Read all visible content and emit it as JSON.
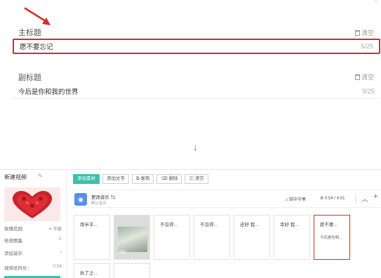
{
  "annotation": {
    "corner_mark": "ʼ",
    "down_arrow": "↓"
  },
  "main_title_field": {
    "label": "主标题",
    "clear": "清空",
    "value": "愿不要忘记",
    "count": "5/25"
  },
  "subtitle_field": {
    "label": "副标题",
    "clear": "清空",
    "value": "今后是你和我的世界",
    "count": "9/25"
  },
  "editor": {
    "project_title": "新建视频",
    "style_row": {
      "label": "玫瑰花园",
      "value": "▾ 浮雕"
    },
    "rows": [
      {
        "label": "修改图集",
        "icon": "A"
      },
      {
        "label": "添加音乐",
        "icon": "♪"
      },
      {
        "label": "视频总时长：",
        "value": "0:54"
      }
    ],
    "toolbar": {
      "add_material": "添加素材",
      "add_text": "添加文字",
      "copy": "复制",
      "delete": "删除",
      "clear": "清空"
    },
    "music": {
      "title": "更改音乐 ⇆",
      "subtitle": "默认音乐",
      "beat": "踩中节奏",
      "timer": "0:54 / 4:01"
    },
    "clips": [
      {
        "text": "雨半丰..."
      },
      {
        "text": "",
        "image_label": "清除"
      },
      {
        "text": "不见得..."
      },
      {
        "text": "不见得..."
      },
      {
        "text": "还好 我..."
      },
      {
        "text": "幸好 我..."
      },
      {
        "text": "愿不要...",
        "sub": "今后是你和..."
      },
      {
        "text": "执了之..."
      },
      {
        "text": ""
      }
    ]
  },
  "colors": {
    "accent": "#3cbfae",
    "highlight": "#d62b2b"
  }
}
